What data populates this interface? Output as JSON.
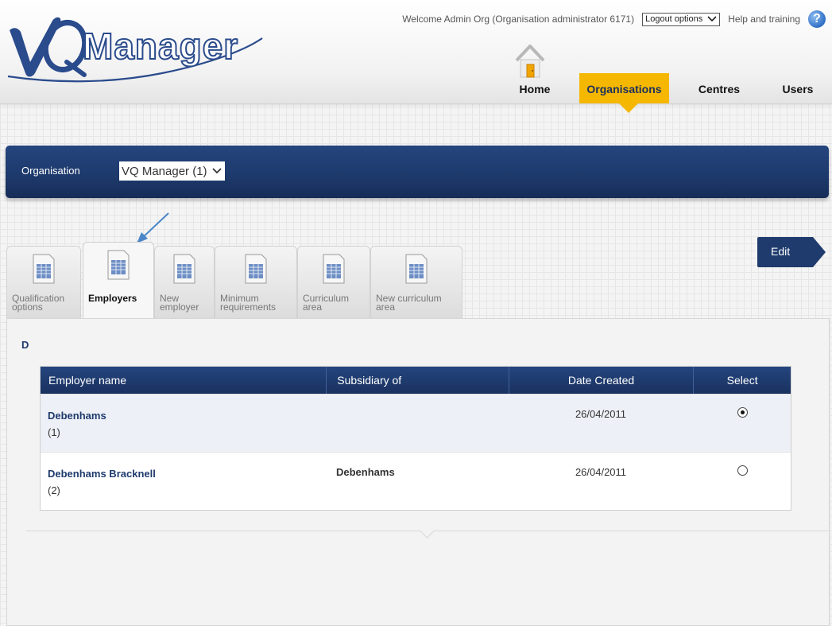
{
  "app": {
    "logo_text": "VQManager"
  },
  "header": {
    "welcome": "Welcome Admin Org (Organisation administrator 6171)",
    "logout_label": "Logout options",
    "help_label": "Help and training",
    "help_icon_glyph": "?"
  },
  "nav": {
    "items": [
      {
        "label": "Home",
        "active": false
      },
      {
        "label": "Organisations",
        "active": true
      },
      {
        "label": "Centres",
        "active": false
      },
      {
        "label": "Users",
        "active": false
      }
    ],
    "accent_color": "#f5b700"
  },
  "org_bar": {
    "label": "Organisation",
    "selected": "VQ Manager (1)",
    "color": "#1e3a6d"
  },
  "tabs": [
    {
      "line1": "Qualification",
      "line2": "options",
      "active": false
    },
    {
      "line1": "Employers",
      "line2": "",
      "active": true
    },
    {
      "line1": "New",
      "line2": "employer",
      "active": false
    },
    {
      "line1": "Minimum",
      "line2": "requirements",
      "active": false
    },
    {
      "line1": "Curriculum",
      "line2": "area",
      "active": false
    },
    {
      "line1": "New curriculum",
      "line2": "area",
      "active": false
    }
  ],
  "content": {
    "letter_filter": "D",
    "table": {
      "columns": [
        "Employer name",
        "Subsidiary of",
        "Date Created",
        "Select"
      ],
      "rows": [
        {
          "name": "Debenhams",
          "id": "(1)",
          "subsidiary_of": "",
          "date_created": "26/04/2011",
          "selected": true
        },
        {
          "name": "Debenhams Bracknell",
          "id": "(2)",
          "subsidiary_of": "Debenhams",
          "date_created": "26/04/2011",
          "selected": false
        }
      ]
    },
    "edit_label": "Edit"
  }
}
